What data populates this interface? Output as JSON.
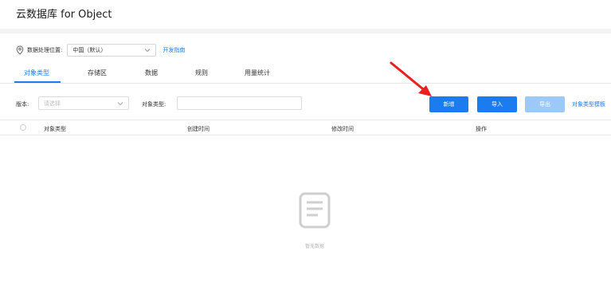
{
  "app": {
    "title": "云数据库 for Object"
  },
  "location": {
    "label": "数据处理位置:",
    "value": "中国（默认）",
    "dev_guide": "开发指南"
  },
  "tabs": [
    {
      "label": "对象类型",
      "active": true
    },
    {
      "label": "存储区",
      "active": false
    },
    {
      "label": "数据",
      "active": false
    },
    {
      "label": "规则",
      "active": false
    },
    {
      "label": "用量统计",
      "active": false
    }
  ],
  "filters": {
    "version_label": "版本:",
    "version_placeholder": "请选择",
    "type_label": "对象类型:",
    "type_value": ""
  },
  "actions": {
    "new_label": "新增",
    "import_label": "导入",
    "export_label": "导出",
    "template_label": "对象类型模板"
  },
  "table": {
    "columns": [
      "对象类型",
      "创建时间",
      "修改时间",
      "操作"
    ],
    "rows": []
  },
  "empty_state": {
    "text": "暂无数据"
  },
  "colors": {
    "accent": "#1a7cf0",
    "disabled_button": "#9cc9f7",
    "annotation_arrow": "#e8211e"
  },
  "icons": {
    "location": "map-pin-icon",
    "dropdown": "chevron-down-icon",
    "empty": "document-icon"
  }
}
